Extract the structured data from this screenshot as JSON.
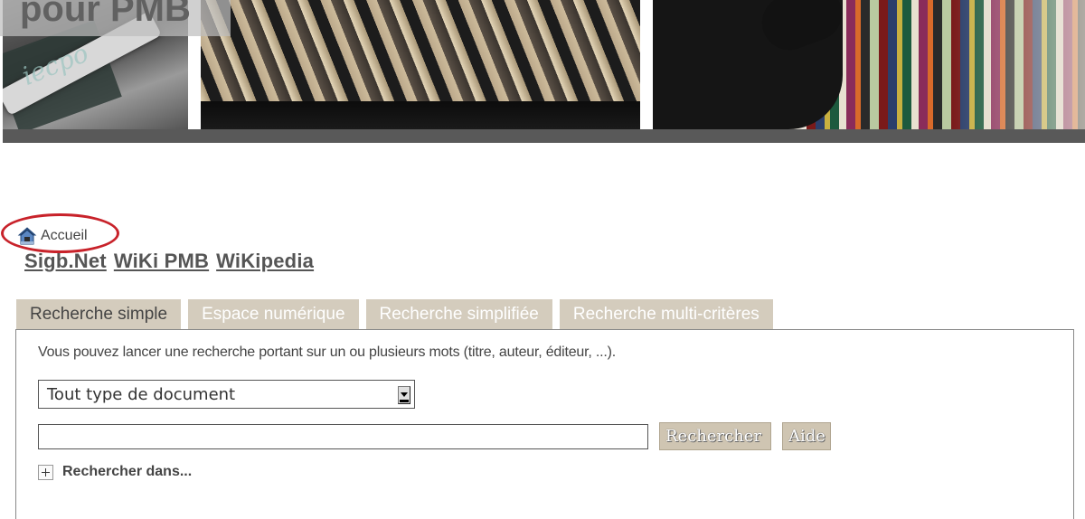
{
  "banner": {
    "title": "pour PMB",
    "left_photo_text": "iecpo"
  },
  "breadcrumb": {
    "home_label": "Accueil"
  },
  "links": [
    {
      "label": "Sigb.Net"
    },
    {
      "label": "WiKi PMB"
    },
    {
      "label": "WiKipedia"
    }
  ],
  "tabs": [
    {
      "label": "Recherche simple",
      "active": true
    },
    {
      "label": "Espace numérique",
      "active": false
    },
    {
      "label": "Recherche simplifiée",
      "active": false
    },
    {
      "label": "Recherche multi-critères",
      "active": false
    }
  ],
  "search": {
    "intro": "Vous pouvez lancer une recherche portant sur un ou plusieurs mots (titre, auteur, éditeur, ...).",
    "doc_type_selected": "Tout type de document",
    "query_value": "",
    "search_button": "Rechercher",
    "help_button": "Aide",
    "more_label": "Rechercher dans..."
  },
  "colors": {
    "tab_bg": "#d4ccbd",
    "button_bg": "#cfc5b2",
    "highlight_circle": "#c8222a",
    "banner_bar": "#595959"
  },
  "icons": {
    "home": "home-icon",
    "expand": "plus-box-icon",
    "select_arrow": "dropdown-arrow-icon"
  }
}
